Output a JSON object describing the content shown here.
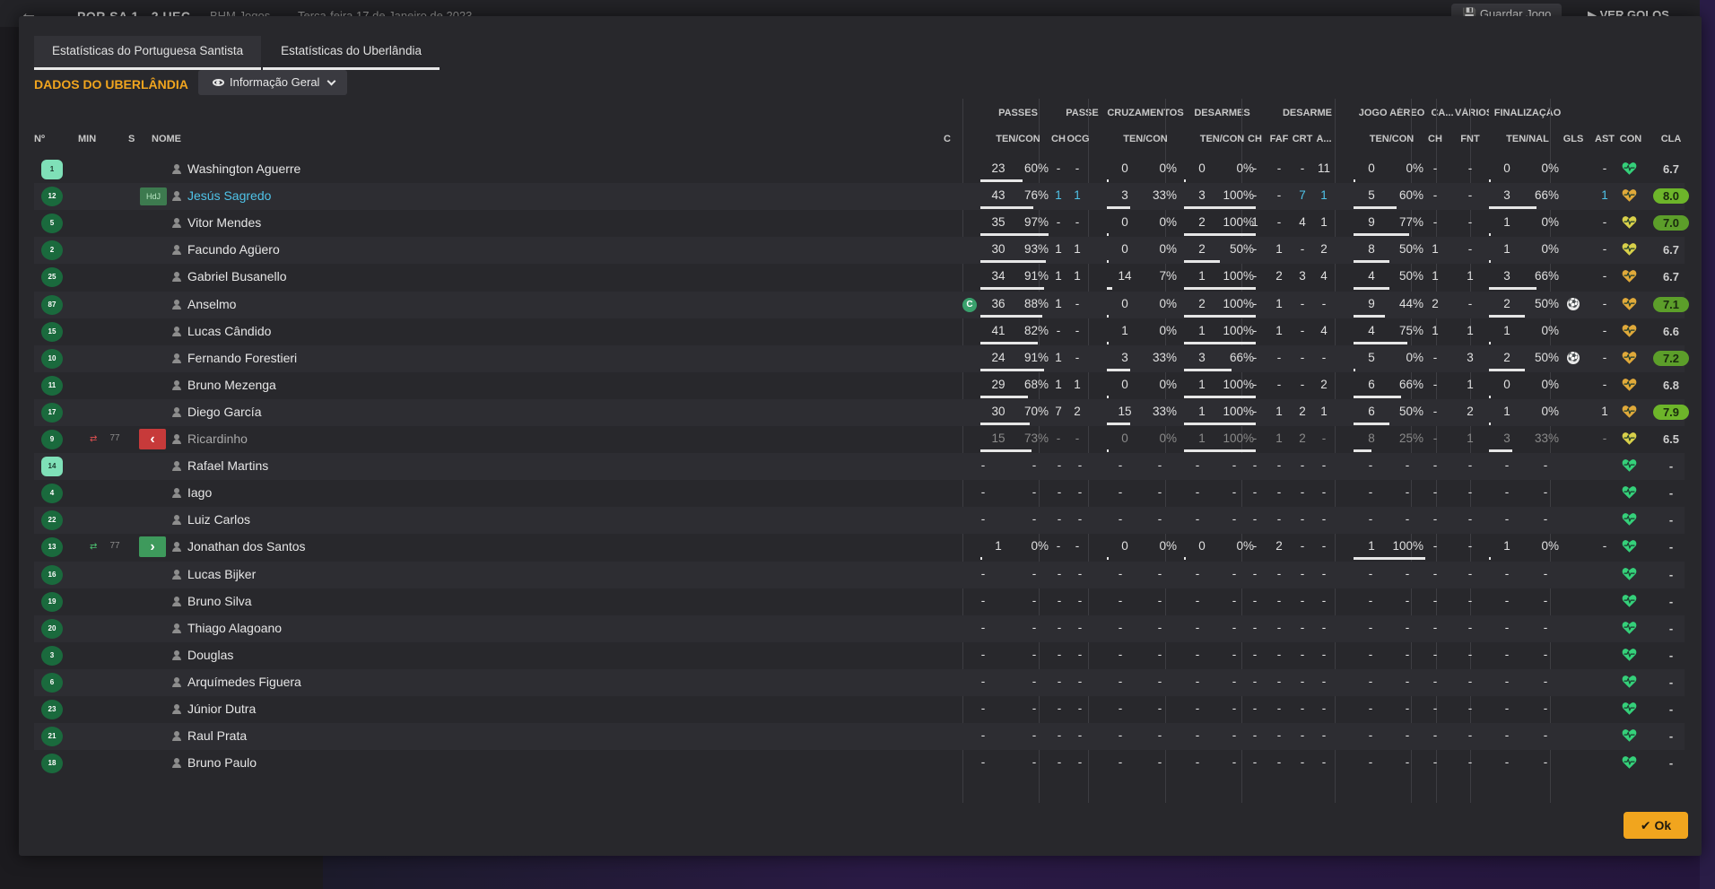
{
  "background": {
    "match_score": "POR SA  1 - 2  UEC",
    "venue": "BHM Jogos",
    "date": "Terça-feira 17 de Janeiro de 2023",
    "save_button": "Guardar Jogo",
    "goals_button": "VER GOLOS"
  },
  "tabs": [
    {
      "label": "Estatísticas do Portuguesa Santista",
      "active": true
    },
    {
      "label": "Estatísticas do Uberlândia",
      "active": false
    }
  ],
  "section_title": "DADOS DO UBERLÂNDIA",
  "view_dropdown": "Informação Geral",
  "group_headers": {
    "passes": "PASSES",
    "passe": "PASSE",
    "cruzamentos": "CRUZAMENTOS",
    "desarmes": "DESARMES",
    "desarme": "DESARME",
    "jogo_aereo": "JOGO AÉREO",
    "ca": "CA...",
    "varios": "VÁRIOS",
    "finalizacao": "FINALIZAÇÃO"
  },
  "columns": {
    "no": "Nº",
    "min": "MIN",
    "s": "S",
    "nome": "NOME",
    "c": "C",
    "pass_tc": "TEN/CON",
    "pass_ch": "CH",
    "pass_ocg": "OCG",
    "cruz_tc": "TEN/CON",
    "des_tc": "TEN/CON",
    "des_ch": "CH",
    "des_faf": "FAF",
    "des_crt": "CRT",
    "des_a": "A...",
    "aer_tc": "TEN/CON",
    "ca_ch": "CH",
    "var_fnt": "FNT",
    "fin_tn": "TEN/NAL",
    "gls": "GLS",
    "ast": "AST",
    "con": "CON",
    "cla": "CLA"
  },
  "ok_button": "Ok",
  "players": [
    {
      "no": "1",
      "gk": true,
      "min": "",
      "name": "Washington Aguerre",
      "pt": "23",
      "pp": "60%",
      "pf": 0.6,
      "pch": "-",
      "pocg": "-",
      "ct": "0",
      "cp": "0%",
      "cf": 0,
      "dt": "0",
      "dp": "0%",
      "df": 0,
      "dch": "-",
      "dfaf": "-",
      "dcrt": "-",
      "da": "11",
      "at": "0",
      "ap": "0%",
      "af": 0,
      "cach": "-",
      "fnt": "-",
      "ft": "0",
      "fp": "0%",
      "ff": 0,
      "gls": "",
      "ast": "-",
      "heart": "green",
      "cla": "6.7",
      "cla_style": "none"
    },
    {
      "no": "12",
      "min": "",
      "badge": "HdJ",
      "name": "Jesús Sagredo",
      "hl": true,
      "pt": "43",
      "pp": "76%",
      "pf": 0.76,
      "pch": "1",
      "pocg": "1",
      "pchc": "cyan",
      "pocgc": "cyan",
      "ct": "3",
      "cp": "33%",
      "cf": 0.33,
      "dt": "3",
      "dp": "100%",
      "df": 1,
      "dch": "-",
      "dfaf": "-",
      "dcrt": "7",
      "da": "1",
      "dcrtc": "cyan",
      "dac": "cyan",
      "at": "5",
      "ap": "60%",
      "af": 0.6,
      "cach": "-",
      "fnt": "-",
      "ft": "3",
      "fp": "66%",
      "ff": 0.66,
      "gls": "",
      "ast": "1",
      "astc": "cyan",
      "heart": "gold",
      "cla": "8.0",
      "cla_style": "good"
    },
    {
      "no": "5",
      "min": "",
      "name": "Vitor Mendes",
      "pt": "35",
      "pp": "97%",
      "pf": 0.97,
      "pch": "-",
      "pocg": "-",
      "ct": "0",
      "cp": "0%",
      "cf": 0,
      "dt": "2",
      "dp": "100%",
      "df": 1,
      "dch": "1",
      "dfaf": "-",
      "dcrt": "4",
      "da": "1",
      "at": "9",
      "ap": "77%",
      "af": 0.77,
      "cach": "-",
      "fnt": "-",
      "ft": "1",
      "fp": "0%",
      "ff": 0,
      "gls": "",
      "ast": "-",
      "heart": "yellow",
      "cla": "7.0",
      "cla_style": "mid"
    },
    {
      "no": "2",
      "min": "",
      "name": "Facundo Agüero",
      "pt": "30",
      "pp": "93%",
      "pf": 0.93,
      "pch": "1",
      "pocg": "1",
      "ct": "0",
      "cp": "0%",
      "cf": 0,
      "dt": "2",
      "dp": "50%",
      "df": 0.5,
      "dch": "-",
      "dfaf": "1",
      "dcrt": "-",
      "da": "2",
      "at": "8",
      "ap": "50%",
      "af": 0.5,
      "cach": "1",
      "fnt": "-",
      "ft": "1",
      "fp": "0%",
      "ff": 0,
      "gls": "",
      "ast": "-",
      "heart": "yellow",
      "cla": "6.7",
      "cla_style": "none"
    },
    {
      "no": "25",
      "min": "",
      "name": "Gabriel Busanello",
      "pt": "34",
      "pp": "91%",
      "pf": 0.91,
      "pch": "1",
      "pocg": "1",
      "ct": "14",
      "cp": "7%",
      "cf": 0.07,
      "dt": "1",
      "dp": "100%",
      "df": 1,
      "dch": "-",
      "dfaf": "2",
      "dcrt": "3",
      "da": "4",
      "at": "4",
      "ap": "50%",
      "af": 0.5,
      "cach": "1",
      "fnt": "1",
      "ft": "3",
      "fp": "66%",
      "ff": 0.66,
      "gls": "",
      "ast": "-",
      "heart": "gold",
      "cla": "6.7",
      "cla_style": "none"
    },
    {
      "no": "87",
      "min": "",
      "name": "Anselmo",
      "cap": "C",
      "pt": "36",
      "pp": "88%",
      "pf": 0.88,
      "pch": "1",
      "pocg": "-",
      "ct": "0",
      "cp": "0%",
      "cf": 0,
      "dt": "2",
      "dp": "100%",
      "df": 1,
      "dch": "-",
      "dfaf": "1",
      "dcrt": "-",
      "da": "-",
      "at": "9",
      "ap": "44%",
      "af": 0.44,
      "cach": "2",
      "fnt": "-",
      "ft": "2",
      "fp": "50%",
      "ff": 0.5,
      "gls": "ball",
      "ast": "-",
      "heart": "gold",
      "cla": "7.1",
      "cla_style": "mid"
    },
    {
      "no": "15",
      "min": "",
      "name": "Lucas Cândido",
      "pt": "41",
      "pp": "82%",
      "pf": 0.82,
      "pch": "-",
      "pocg": "-",
      "ct": "1",
      "cp": "0%",
      "cf": 0,
      "dt": "1",
      "dp": "100%",
      "df": 1,
      "dch": "-",
      "dfaf": "1",
      "dcrt": "-",
      "da": "4",
      "at": "4",
      "ap": "75%",
      "af": 0.75,
      "cach": "1",
      "fnt": "1",
      "ft": "1",
      "fp": "0%",
      "ff": 0,
      "gls": "",
      "ast": "-",
      "heart": "gold",
      "cla": "6.6",
      "cla_style": "none"
    },
    {
      "no": "10",
      "min": "",
      "name": "Fernando Forestieri",
      "pt": "24",
      "pp": "91%",
      "pf": 0.91,
      "pch": "1",
      "pocg": "-",
      "ct": "3",
      "cp": "33%",
      "cf": 0.33,
      "dt": "3",
      "dp": "66%",
      "df": 0.66,
      "dch": "-",
      "dfaf": "-",
      "dcrt": "-",
      "da": "-",
      "at": "5",
      "ap": "0%",
      "af": 0,
      "cach": "-",
      "fnt": "3",
      "ft": "2",
      "fp": "50%",
      "ff": 0.5,
      "gls": "ball",
      "ast": "-",
      "heart": "gold",
      "cla": "7.2",
      "cla_style": "mid"
    },
    {
      "no": "11",
      "min": "",
      "name": "Bruno Mezenga",
      "pt": "29",
      "pp": "68%",
      "pf": 0.68,
      "pch": "1",
      "pocg": "1",
      "ct": "0",
      "cp": "0%",
      "cf": 0,
      "dt": "1",
      "dp": "100%",
      "df": 1,
      "dch": "-",
      "dfaf": "-",
      "dcrt": "-",
      "da": "2",
      "at": "6",
      "ap": "66%",
      "af": 0.66,
      "cach": "-",
      "fnt": "1",
      "ft": "0",
      "fp": "0%",
      "ff": 0,
      "gls": "",
      "ast": "-",
      "heart": "gold",
      "cla": "6.8",
      "cla_style": "none"
    },
    {
      "no": "17",
      "min": "",
      "name": "Diego García",
      "pt": "30",
      "pp": "70%",
      "pf": 0.7,
      "pch": "7",
      "pocg": "2",
      "ct": "15",
      "cp": "33%",
      "cf": 0.33,
      "dt": "1",
      "dp": "100%",
      "df": 1,
      "dch": "-",
      "dfaf": "1",
      "dcrt": "2",
      "da": "1",
      "at": "6",
      "ap": "50%",
      "af": 0.5,
      "cach": "-",
      "fnt": "2",
      "ft": "1",
      "fp": "0%",
      "ff": 0,
      "gls": "",
      "ast": "1",
      "heart": "gold",
      "cla": "7.9",
      "cla_style": "good"
    },
    {
      "no": "9",
      "min": "77",
      "sub": "out",
      "subbed": true,
      "name": "Ricardinho",
      "pt": "15",
      "pp": "73%",
      "pf": 0.73,
      "pch": "-",
      "pocg": "-",
      "ct": "0",
      "cp": "0%",
      "cf": 0,
      "dt": "1",
      "dp": "100%",
      "df": 1,
      "dch": "-",
      "dfaf": "1",
      "dcrt": "2",
      "da": "-",
      "at": "8",
      "ap": "25%",
      "af": 0.25,
      "cach": "-",
      "fnt": "1",
      "ft": "3",
      "fp": "33%",
      "ff": 0.33,
      "gls": "",
      "ast": "-",
      "heart": "yellow",
      "cla": "6.5",
      "cla_style": "none",
      "dimmed": true
    },
    {
      "no": "14",
      "gk": true,
      "min": "",
      "name": "Rafael Martins",
      "sub_list": true,
      "heart": "green",
      "cla": "-"
    },
    {
      "no": "4",
      "min": "",
      "name": "Iago",
      "sub_list": true,
      "heart": "green",
      "cla": "-"
    },
    {
      "no": "22",
      "min": "",
      "name": "Luiz Carlos",
      "sub_list": true,
      "heart": "green",
      "cla": "-"
    },
    {
      "no": "13",
      "min": "77",
      "sub": "in",
      "name": "Jonathan dos Santos",
      "pt": "1",
      "pp": "0%",
      "pf": 0,
      "pch": "-",
      "pocg": "-",
      "ct": "0",
      "cp": "0%",
      "cf": 0,
      "dt": "0",
      "dp": "0%",
      "df": 0,
      "dch": "-",
      "dfaf": "2",
      "dcrt": "-",
      "da": "-",
      "at": "1",
      "ap": "100%",
      "af": 1,
      "cach": "-",
      "fnt": "-",
      "ft": "1",
      "fp": "0%",
      "ff": 0,
      "gls": "",
      "ast": "-",
      "heart": "green",
      "cla": "-",
      "cla_style": "none"
    },
    {
      "no": "16",
      "min": "",
      "name": "Lucas Bijker",
      "sub_list": true,
      "heart": "green",
      "cla": "-"
    },
    {
      "no": "19",
      "min": "",
      "name": "Bruno Silva",
      "sub_list": true,
      "heart": "green",
      "cla": "-"
    },
    {
      "no": "20",
      "min": "",
      "name": "Thiago Alagoano",
      "sub_list": true,
      "heart": "green",
      "cla": "-"
    },
    {
      "no": "3",
      "min": "",
      "name": "Douglas",
      "sub_list": true,
      "heart": "green",
      "cla": "-"
    },
    {
      "no": "6",
      "min": "",
      "name": "Arquímedes Figuera",
      "sub_list": true,
      "heart": "green",
      "cla": "-"
    },
    {
      "no": "23",
      "min": "",
      "name": "Júnior Dutra",
      "sub_list": true,
      "heart": "green",
      "cla": "-"
    },
    {
      "no": "21",
      "min": "",
      "name": "Raul Prata",
      "sub_list": true,
      "heart": "green",
      "cla": "-"
    },
    {
      "no": "18",
      "min": "",
      "name": "Bruno Paulo",
      "sub_list": true,
      "heart": "green",
      "cla": "-"
    }
  ],
  "colors": {
    "accent": "#f1a51e",
    "cyan": "#4fc3e8",
    "heart_green": "#35d07a",
    "heart_gold": "#e0a93a",
    "heart_yellow": "#d8d04a"
  }
}
